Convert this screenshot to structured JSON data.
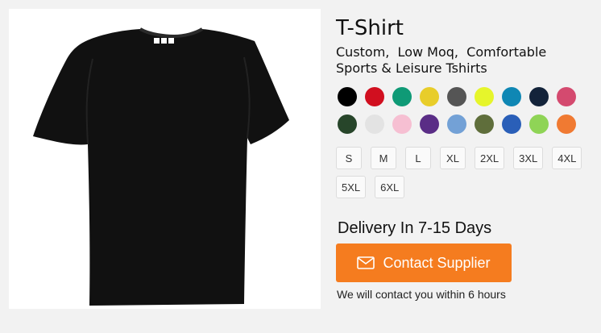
{
  "product": {
    "title": "T-Shirt",
    "subtitle": "Custom,  Low Moq,  Comfortable Sports & Leisure Tshirts",
    "image_icon": "black-tshirt-image"
  },
  "colors": [
    {
      "name": "black",
      "hex": "#000000"
    },
    {
      "name": "red",
      "hex": "#d10f1f"
    },
    {
      "name": "teal-green",
      "hex": "#0f9a76"
    },
    {
      "name": "yellow",
      "hex": "#e8cd2a"
    },
    {
      "name": "dark-gray",
      "hex": "#555555"
    },
    {
      "name": "lime",
      "hex": "#e6f52b"
    },
    {
      "name": "cyan-blue",
      "hex": "#0f87b4"
    },
    {
      "name": "navy",
      "hex": "#13233a"
    },
    {
      "name": "rose",
      "hex": "#d44a6f"
    },
    {
      "name": "dark-green",
      "hex": "#27452a"
    },
    {
      "name": "light-gray",
      "hex": "#e3e3e3"
    },
    {
      "name": "pink",
      "hex": "#f6bfd2"
    },
    {
      "name": "purple",
      "hex": "#5a2d86"
    },
    {
      "name": "light-blue",
      "hex": "#73a1d6"
    },
    {
      "name": "olive",
      "hex": "#5f6e3b"
    },
    {
      "name": "royal-blue",
      "hex": "#2a5fb8"
    },
    {
      "name": "light-green",
      "hex": "#8fd456"
    },
    {
      "name": "orange",
      "hex": "#f07a32"
    }
  ],
  "sizes": [
    "S",
    "M",
    "L",
    "XL",
    "2XL",
    "3XL",
    "4XL",
    "5XL",
    "6XL"
  ],
  "delivery": "Delivery In 7-15 Days",
  "contact": {
    "button_label": "Contact Supplier",
    "icon": "envelope-icon",
    "note": "We will contact you within 6 hours",
    "accent": "#f57c1f"
  }
}
